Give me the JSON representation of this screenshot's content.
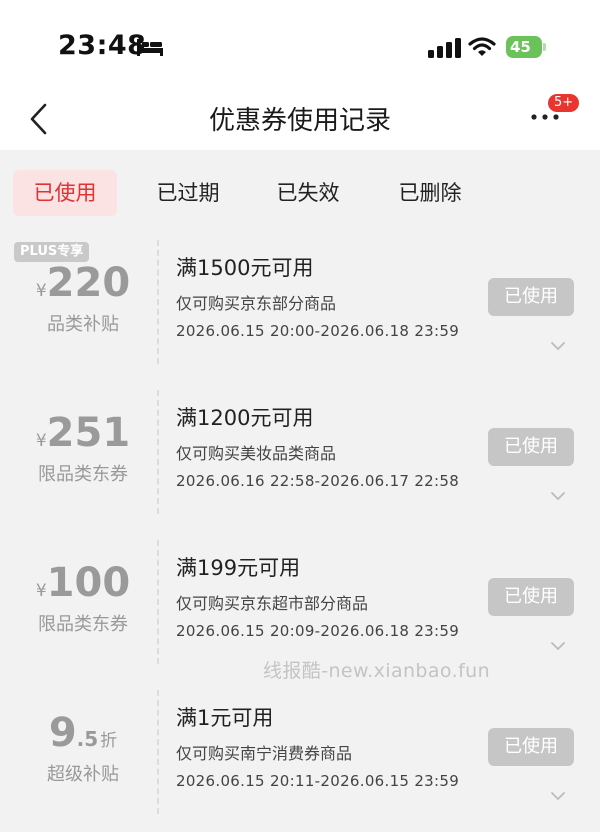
{
  "status_bar": {
    "time": "23:48",
    "battery": "45"
  },
  "nav": {
    "title": "优惠券使用记录",
    "badge": "5+"
  },
  "tabs": [
    {
      "label": "已使用",
      "active": true
    },
    {
      "label": "已过期",
      "active": false
    },
    {
      "label": "已失效",
      "active": false
    },
    {
      "label": "已删除",
      "active": false
    }
  ],
  "coupons": [
    {
      "badge": "PLUS专享",
      "currency": "¥",
      "amount": "220",
      "label": "品类补贴",
      "condition": "满1500元可用",
      "scope": "仅可购买京东部分商品",
      "validity": "2026.06.15 20:00-2026.06.18 23:59",
      "status": "已使用"
    },
    {
      "currency": "¥",
      "amount": "251",
      "label": "限品类东券",
      "condition": "满1200元可用",
      "scope": "仅可购买美妆品类商品",
      "validity": "2026.06.16 22:58-2026.06.17 22:58",
      "status": "已使用"
    },
    {
      "currency": "¥",
      "amount": "100",
      "label": "限品类东券",
      "condition": "满199元可用",
      "scope": "仅可购买京东超市部分商品",
      "validity": "2026.06.15 20:09-2026.06.18 23:59",
      "status": "已使用"
    },
    {
      "amount_main": "9",
      "amount_decimal": ".5",
      "amount_unit": "折",
      "label": "超级补贴",
      "condition": "满1元可用",
      "scope": "仅可购买南宁消费券商品",
      "validity": "2026.06.15 20:11-2026.06.15 23:59",
      "status": "已使用"
    }
  ],
  "watermark": "线报酷-new.xianbao.fun"
}
